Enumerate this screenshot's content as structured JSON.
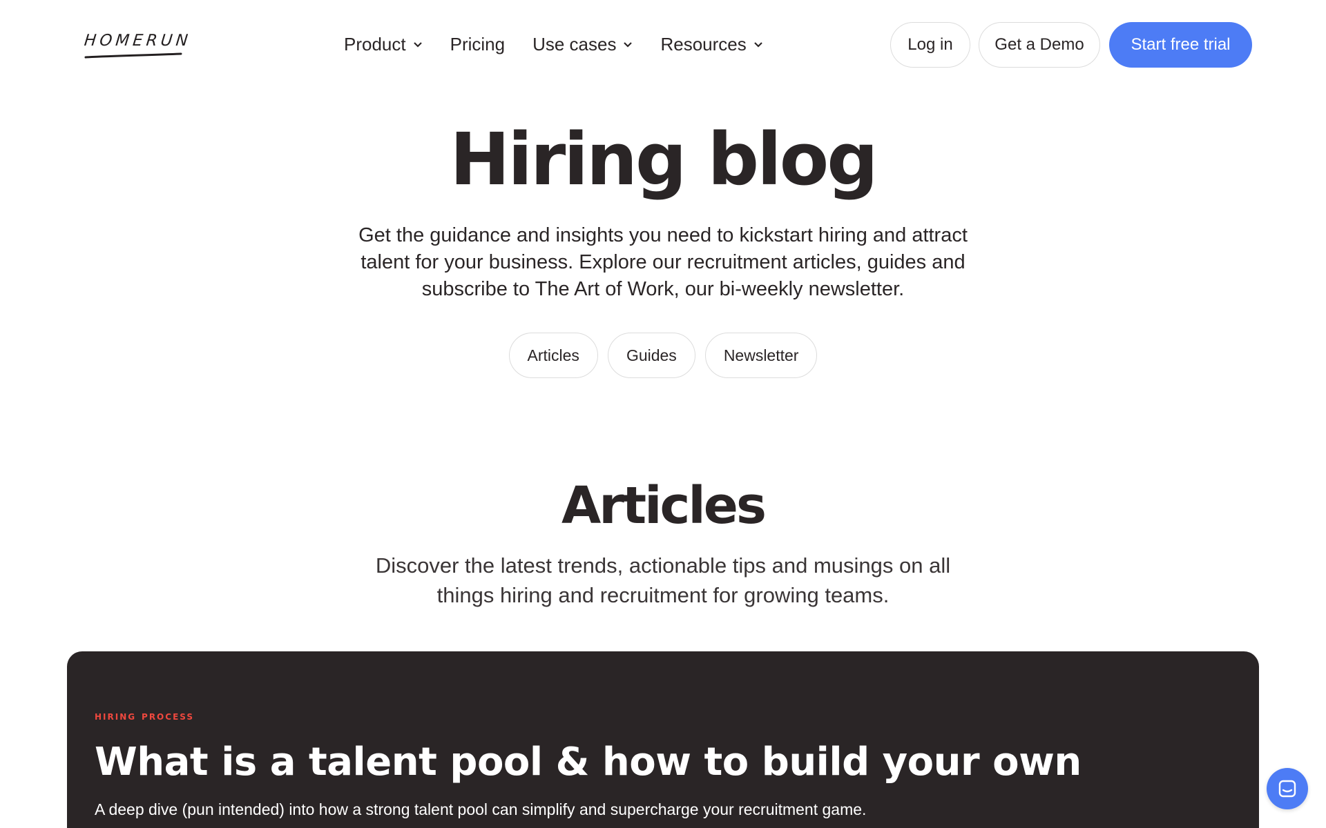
{
  "nav": {
    "logo_text": "HOMERUN",
    "menu": [
      {
        "label": "Product",
        "has_dropdown": true
      },
      {
        "label": "Pricing",
        "has_dropdown": false
      },
      {
        "label": "Use cases",
        "has_dropdown": true
      },
      {
        "label": "Resources",
        "has_dropdown": true
      }
    ],
    "login_label": "Log in",
    "demo_label": "Get a Demo",
    "trial_label": "Start free trial"
  },
  "hero": {
    "title": "Hiring blog",
    "subtitle": "Get the guidance and insights you need to kickstart hiring and attract talent for your business. Explore our recruitment articles, guides and subscribe to The Art of Work, our bi-weekly newsletter.",
    "pills": [
      "Articles",
      "Guides",
      "Newsletter"
    ]
  },
  "articles_section": {
    "title": "Articles",
    "subtitle": "Discover the latest trends, actionable tips and musings on all things hiring and recruitment for growing teams."
  },
  "featured_card": {
    "tag": "HIRING PROCESS",
    "title": "What is a talent pool & how to build your own",
    "description": "A deep dive (pun intended) into how a strong talent pool can simplify and supercharge your recruitment game."
  },
  "colors": {
    "primary": "#4d7cf5",
    "dark": "#2a2526",
    "tag_red": "#f0483e"
  },
  "icons": {
    "chat": "chat-icon",
    "chevron": "chevron-down-icon"
  }
}
